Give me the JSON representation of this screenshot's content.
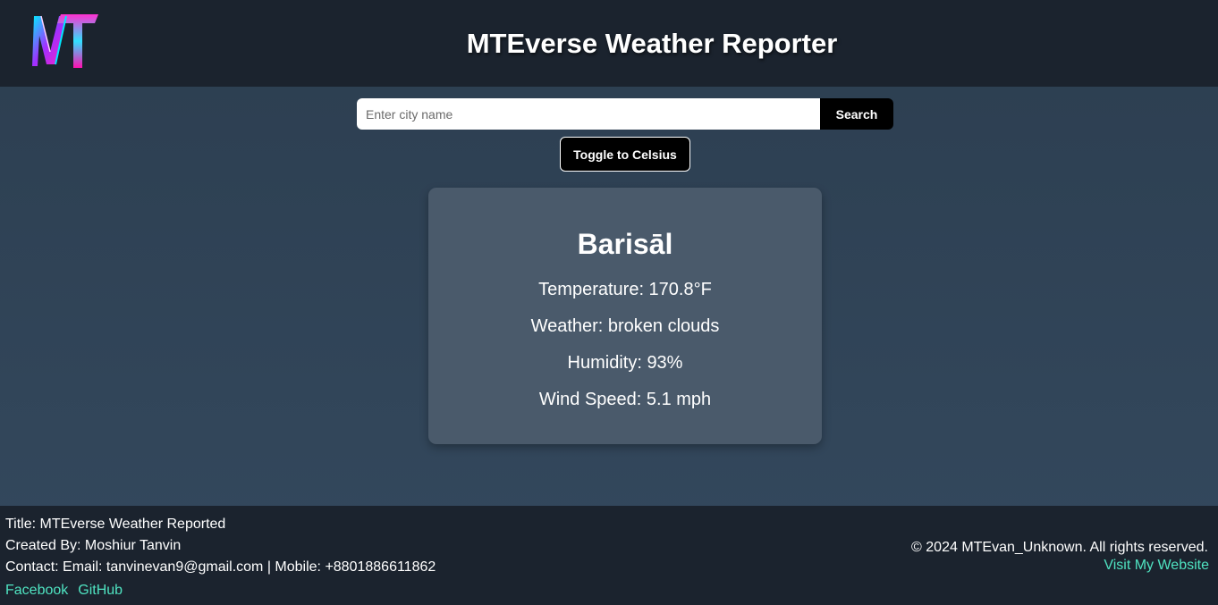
{
  "header": {
    "title": "MTEverse Weather Reporter"
  },
  "search": {
    "placeholder": "Enter city name",
    "value": "",
    "button_label": "Search"
  },
  "toggle": {
    "label": "Toggle to Celsius"
  },
  "weather": {
    "city": "Barisāl",
    "temperature": "Temperature: 170.8°F",
    "description": "Weather: broken clouds",
    "humidity": "Humidity: 93%",
    "wind_speed": "Wind Speed: 5.1 mph"
  },
  "footer": {
    "title_line": "Title: MTEverse Weather Reported",
    "created_by": "Created By: Moshiur Tanvin",
    "contact": "Contact: Email: tanvinevan9@gmail.com | Mobile: +8801886611862",
    "links": [
      "Facebook",
      "GitHub"
    ],
    "copyright": "© 2024 MTEvan_Unknown. All rights reserved.",
    "website_link": "Visit My Website"
  },
  "colors": {
    "header_bg": "#1b232e",
    "page_bg_top": "#2c3e50",
    "card_bg": "#4a5a6b",
    "link": "#4fe3c1"
  }
}
